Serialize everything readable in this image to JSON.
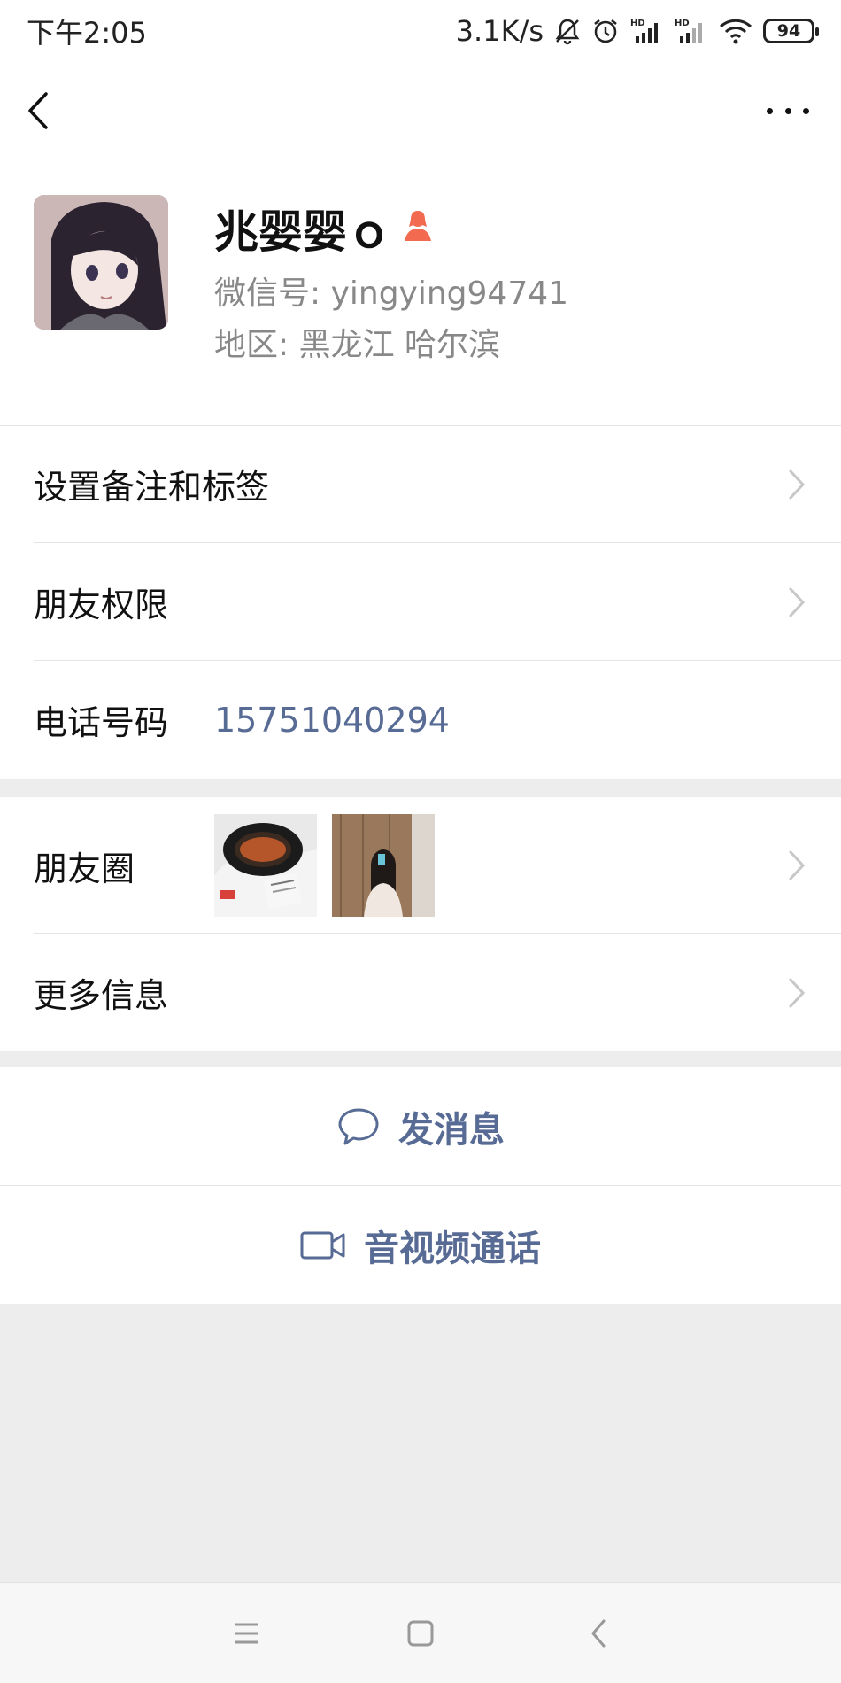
{
  "status_bar": {
    "time": "下午2:05",
    "network_speed": "3.1K/s",
    "battery": "94",
    "icons": [
      "mute-bell-icon",
      "alarm-icon",
      "hd-signal-icon",
      "hd-signal-icon",
      "wifi-icon",
      "battery-icon"
    ]
  },
  "profile": {
    "name": "兆婴婴ｏ",
    "gender_icon": "female-icon",
    "gender_color": "#f26b50",
    "wechat_id": "微信号: yingying94741",
    "region": "地区: 黑龙江  哈尔滨"
  },
  "list1": {
    "remark_label": "设置备注和标签",
    "permission_label": "朋友权限",
    "phone_label": "电话号码",
    "phone_value": "15751040294"
  },
  "list2": {
    "moments_label": "朋友圈",
    "more_info_label": "更多信息"
  },
  "actions": {
    "message_label": "发消息",
    "call_label": "音视频通话"
  },
  "colors": {
    "link": "#576b95",
    "background": "#ededed"
  }
}
